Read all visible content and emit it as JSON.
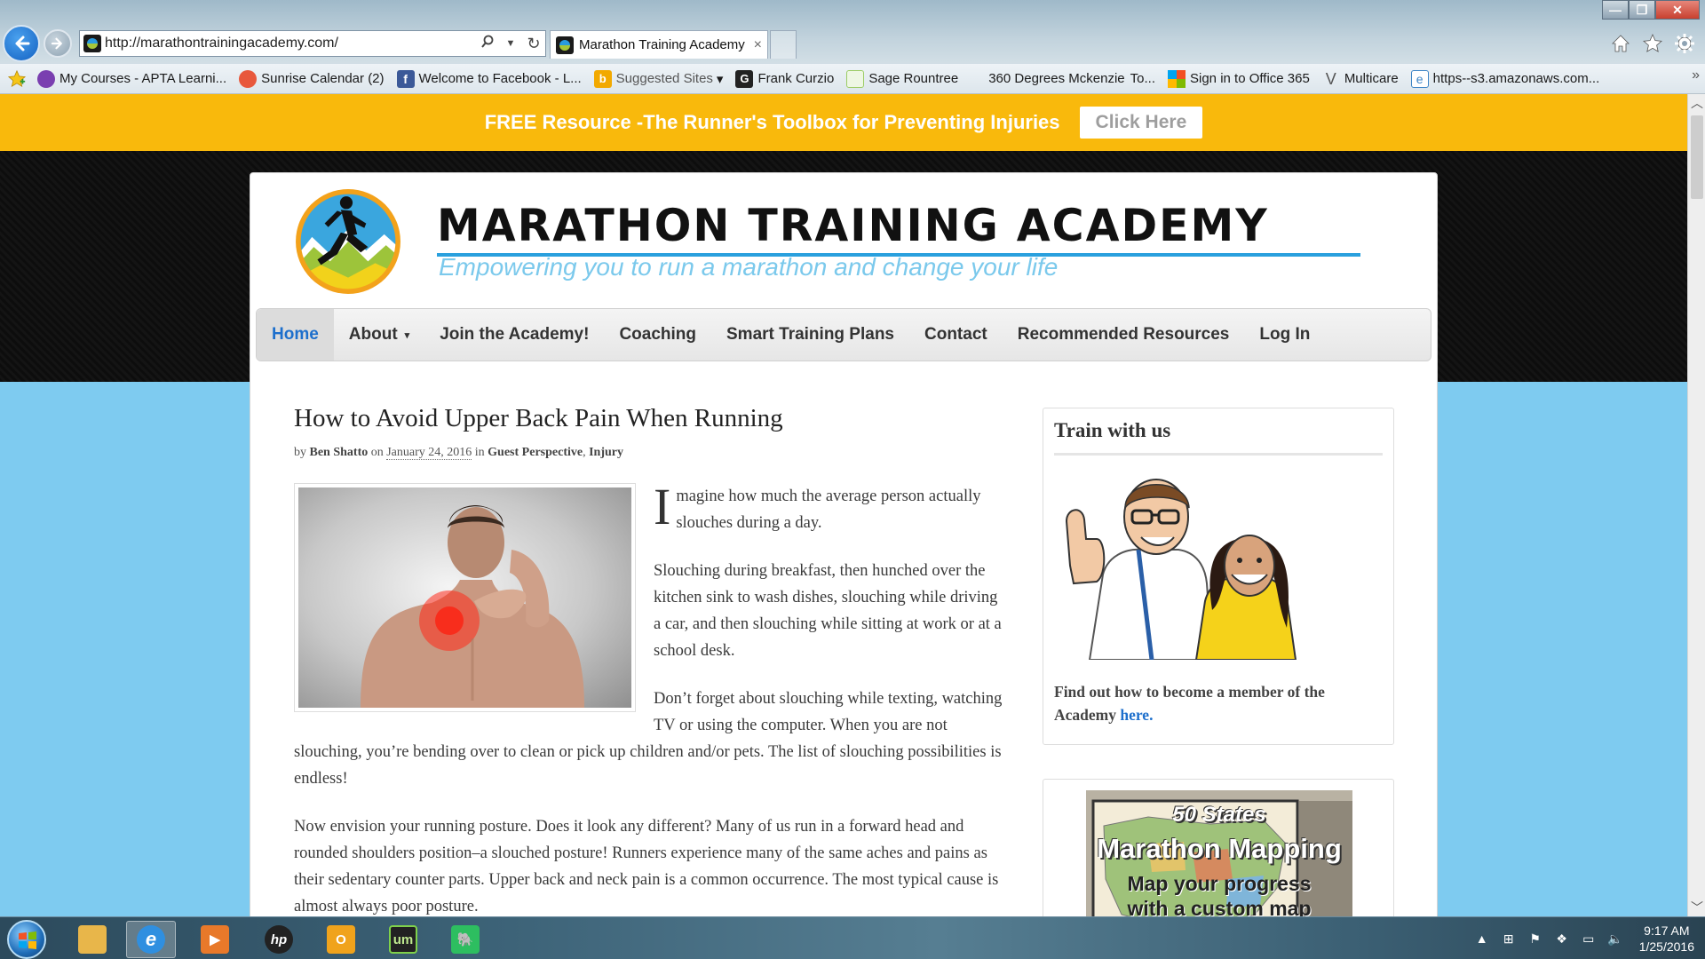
{
  "browser": {
    "address_url": "http://marathontrainingacademy.com/",
    "tab_title": "Marathon Training Academy",
    "tab_close": "×",
    "favorites": [
      {
        "label": "My Courses - APTA Learni...",
        "color": "#7a3fb0"
      },
      {
        "label": "Sunrise Calendar (2)",
        "color": "#e8583c"
      },
      {
        "label": "Welcome to Facebook - L...",
        "color": "#3b5998"
      },
      {
        "label": "Suggested Sites",
        "color": "#f2a900",
        "dropdown": "▾"
      },
      {
        "label": "Frank Curzio",
        "color": "#222222"
      },
      {
        "label": "Sage Rountree",
        "color": "#9ccc65"
      },
      {
        "label": "360 Degrees Mckenzie",
        "color": ""
      },
      {
        "label": "To...",
        "color": ""
      },
      {
        "label": "Sign in to Office 365",
        "color": "#e94e1b"
      },
      {
        "label": "Multicare",
        "color": "#555555"
      },
      {
        "label": "https--s3.amazonaws.com...",
        "color": "#3d85c6"
      }
    ],
    "favorites_overflow": "»"
  },
  "promo": {
    "text": "FREE Resource -The Runner's Toolbox for Preventing Injuries",
    "button": "Click Here",
    "color": "#f9b90c"
  },
  "site": {
    "title": "MARATHON TRAINING ACADEMY",
    "tagline": "Empowering you to run a marathon and change your life",
    "accent": "#29a0de"
  },
  "nav": [
    {
      "label": "Home",
      "active": true
    },
    {
      "label": "About",
      "caret": "▾"
    },
    {
      "label": "Join the Academy!"
    },
    {
      "label": "Coaching"
    },
    {
      "label": "Smart Training Plans"
    },
    {
      "label": "Contact"
    },
    {
      "label": "Recommended Resources"
    },
    {
      "label": "Log In"
    }
  ],
  "article": {
    "title": "How to Avoid Upper Back Pain When Running",
    "byline": {
      "by": "by",
      "author": "Ben Shatto",
      "on": "on",
      "date": "January 24, 2016",
      "in": "in",
      "cat1": "Guest Perspective",
      "sep": ",",
      "cat2": "Injury"
    },
    "drop_cap": "I",
    "p1": "magine how much the average person actually slouches during a day.",
    "p2": "Slouching during breakfast, then hunched over the kitchen sink to wash dishes, slouching while driving a car, and then slouching while sitting at work or at a school desk.",
    "p3": "Don’t forget about slouching while texting, watching TV or using the computer. When you are not slouching, you’re bending over to clean or pick up children and/or pets. The list of slouching possibilities is endless!",
    "p4": "Now envision your running posture. Does it look any different? Many of us run in a forward head and rounded shoulders position–a slouched posture! Runners experience many of the same aches and pains as their sedentary counter parts. Upper back and neck pain is a common occurrence. The most typical cause is almost always poor posture."
  },
  "sidebar": {
    "widget_title": "Train with us",
    "widget_text": "Find out how to become a member of the Academy",
    "widget_link": "here.",
    "map_line1": "50 States",
    "map_line2": "Marathon Mapping",
    "map_line3": "Map your progress",
    "map_line4": "with a custom map"
  },
  "taskbar": {
    "apps": [
      {
        "name": "file-explorer",
        "color": "#e8b64a"
      },
      {
        "name": "internet-explorer",
        "color": "#2f8fe0",
        "active": true
      },
      {
        "name": "media-player",
        "color": "#e8792a"
      },
      {
        "name": "hp",
        "color": "#222222",
        "glyph": "hp"
      },
      {
        "name": "outlook",
        "color": "#f0a31c",
        "glyph": "O"
      },
      {
        "name": "um",
        "color": "#222222",
        "glyph": "um"
      },
      {
        "name": "evernote",
        "color": "#2dbe60"
      }
    ],
    "time": "9:17 AM",
    "date": "1/25/2016"
  }
}
